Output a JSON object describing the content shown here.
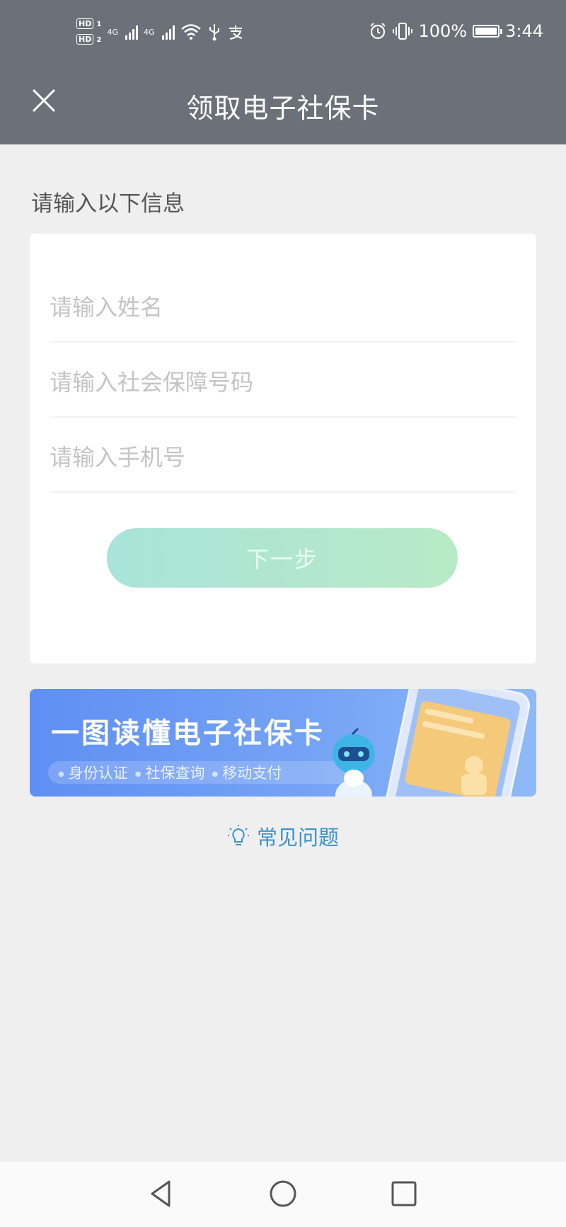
{
  "status_bar": {
    "hd1": "HD",
    "hd1_sub": "1",
    "hd2": "HD",
    "hd2_sub": "2",
    "net1": "4G",
    "net2": "4G",
    "battery_text": "100%",
    "time": "3:44",
    "icons": [
      "signal-icon",
      "wifi-icon",
      "usb-icon",
      "alipay-icon",
      "alarm-icon",
      "vibrate-icon",
      "battery-charging-icon"
    ]
  },
  "header": {
    "title": "领取电子社保卡",
    "close_icon": "close-icon"
  },
  "form": {
    "section_title": "请输入以下信息",
    "name_placeholder": "请输入姓名",
    "ssn_placeholder": "请输入社会保障号码",
    "phone_placeholder": "请输入手机号",
    "next_label": "下一步"
  },
  "banner": {
    "title": "一图读懂电子社保卡",
    "tags": [
      "身份认证",
      "社保查询",
      "移动支付"
    ]
  },
  "faq": {
    "label": "常见问题",
    "icon": "lightbulb-icon"
  },
  "nav_bar": {
    "icons": [
      "back-triangle-icon",
      "home-circle-icon",
      "recents-square-icon"
    ]
  },
  "colors": {
    "header_bg": "#6b7178",
    "page_bg": "#efefef",
    "button_gradient_start": "#a9e3da",
    "button_gradient_end": "#b8eac6",
    "banner_blue": "#5f8ff3",
    "faq_blue": "#3a93c9"
  }
}
